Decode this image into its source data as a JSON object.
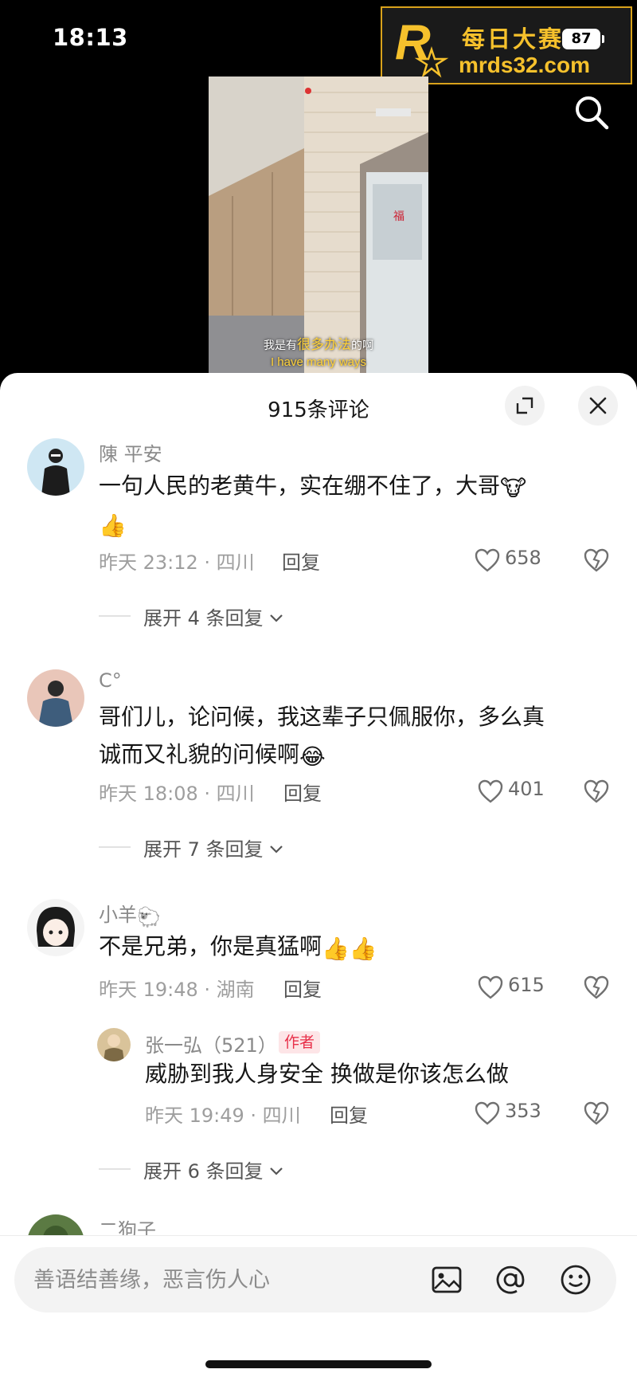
{
  "status_bar": {
    "time": "18:13",
    "battery": "87"
  },
  "watermark": {
    "logo_text": "R",
    "logo_sub": "每日大赛",
    "name": "每日大赛",
    "url": "mrds32.com"
  },
  "video": {
    "caption_pre": "我是有",
    "caption_highlight": "很多办法",
    "caption_post": "的啊",
    "subtitle": "I have many ways"
  },
  "comments_panel": {
    "title": "915条评论",
    "input_placeholder": "善语结善缘，恶言伤人心",
    "reply_label": "回复"
  },
  "comments": [
    {
      "name": "陳 平安",
      "text_line1": "一句人民的老黄牛，实在绷不住了，大哥",
      "emoji_after_line1": "🐮",
      "text_line2_emoji": "👍",
      "meta": "昨天 23:12 · 四川",
      "likes": "658",
      "expand": "展开 4 条回复"
    },
    {
      "name": "C°",
      "text_line1": "哥们儿，论问候，我这辈子只佩服你，多么真",
      "text_line2": "诚而又礼貌的问候啊",
      "emoji_after_line2": "😂",
      "meta": "昨天 18:08 · 四川",
      "likes": "401",
      "expand": "展开 7 条回复"
    },
    {
      "name": "小羊",
      "name_emoji": "🐑",
      "text": "不是兄弟，你是真猛啊",
      "emojis": "👍👍",
      "meta": "昨天 19:48 · 湖南",
      "likes": "615",
      "reply": {
        "name": "张一弘（521）",
        "badge": "作者",
        "text": "威胁到我人身安全 换做是你该怎么做",
        "meta": "昨天 19:49 · 四川",
        "likes": "353"
      },
      "expand": "展开 6 条回复"
    },
    {
      "name": "二狗子"
    }
  ],
  "colors": {
    "badge_bg": "#fde5e7",
    "badge_text": "#e8304a",
    "watermark_gold": "#f6c12c"
  }
}
